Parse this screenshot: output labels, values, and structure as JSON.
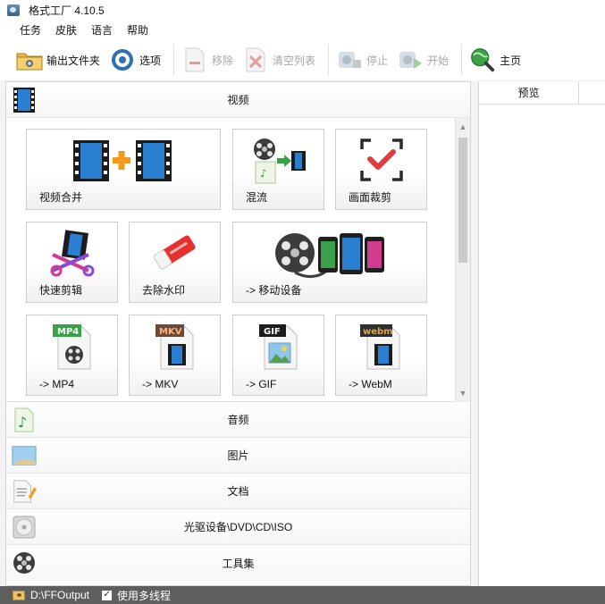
{
  "window": {
    "title": "格式工厂 4.10.5"
  },
  "menu": [
    "任务",
    "皮肤",
    "语言",
    "帮助"
  ],
  "toolbar": {
    "output_folder": "输出文件夹",
    "options": "选项",
    "remove": "移除",
    "clear_list": "清空列表",
    "stop": "停止",
    "start": "开始",
    "home": "主页"
  },
  "categories": {
    "video": "视频",
    "audio": "音频",
    "image": "图片",
    "document": "文档",
    "disc": "光驱设备\\DVD\\CD\\ISO",
    "tools": "工具集"
  },
  "video_tiles": {
    "merge": "视频合并",
    "mux": "混流",
    "crop": "画面裁剪",
    "quick_cut": "快速剪辑",
    "watermark": "去除水印",
    "mobile": "-> 移动设备",
    "mp4": "-> MP4",
    "mkv": "-> MKV",
    "gif": "-> GIF",
    "webm": "-> WebM"
  },
  "format_badges": {
    "mp4": "MP4",
    "mkv": "MKV",
    "gif": "GIF",
    "webm": "webm"
  },
  "preview": {
    "column": "预览"
  },
  "status": {
    "output_path": "D:\\FFOutput",
    "multithread_label": "使用多线程",
    "multithread_checked": true
  },
  "colors": {
    "status_bar": "#5e5e5e",
    "accent_red": "#e23b3b",
    "accent_green": "#3aa04a",
    "film_blue": "#2a7fd0"
  }
}
